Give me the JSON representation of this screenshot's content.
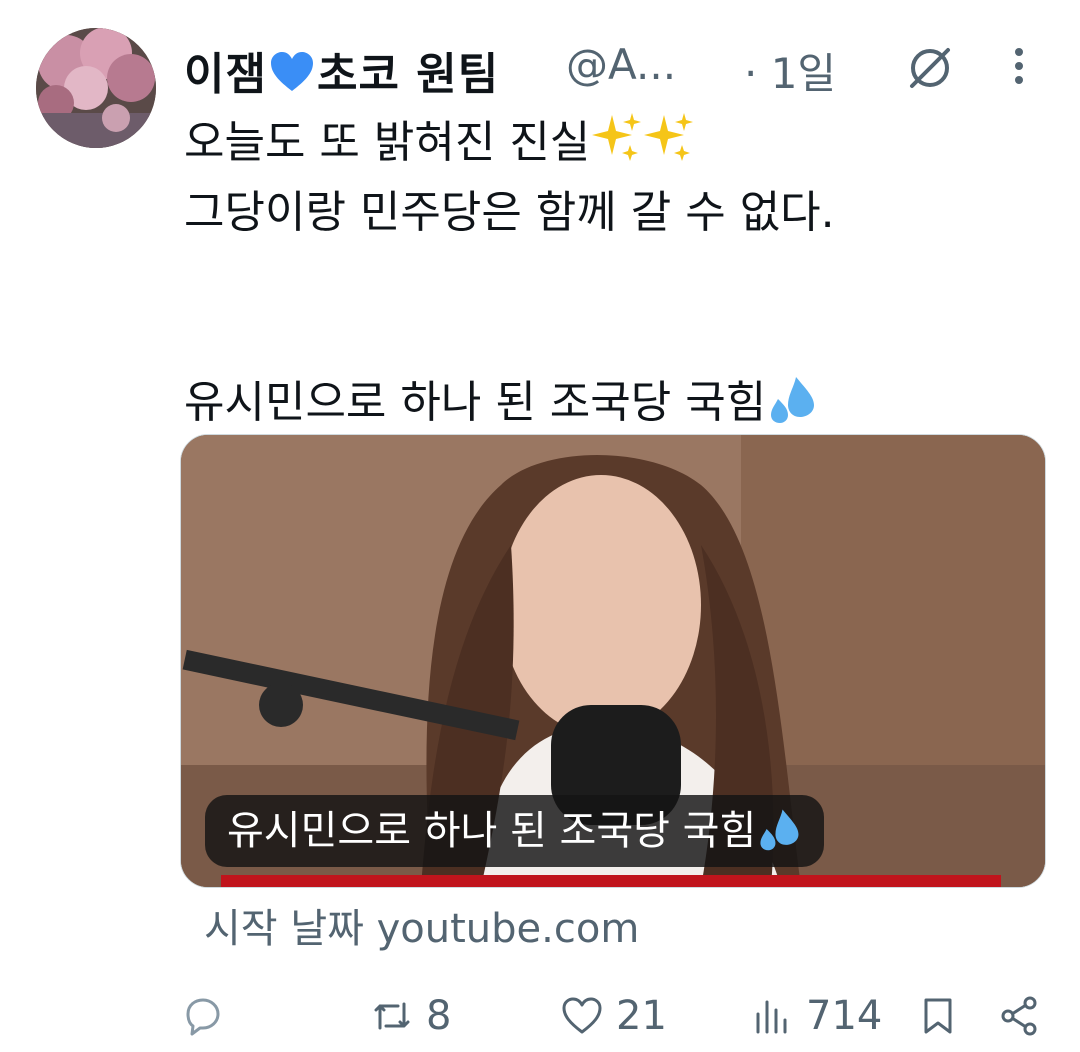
{
  "tweet": {
    "display_name_prefix": "이잼",
    "display_name_suffix": "초코 원팀",
    "handle": "@A...",
    "time": "· 1일",
    "text_line1": "오늘도 또 밝혀진 진실",
    "text_line2": "그당이랑 민주당은 함께 갈 수 없다.",
    "text_line3": "유시민으로 하나 된 조국당 국힘",
    "card_caption": "유시민으로 하나 된 조국당 국힘",
    "source_label": "시작 날짜 youtube.com"
  },
  "actions": {
    "reply_count": "",
    "retweet_count": "8",
    "like_count": "21",
    "views_count": "714"
  },
  "icons": {
    "heart_emoji": "blue-heart-icon",
    "sparkles": "sparkles-icon",
    "drops": "sweat-droplets-icon",
    "grok": "grok-icon",
    "more": "more-icon",
    "reply": "reply-icon",
    "retweet": "retweet-icon",
    "like": "like-icon",
    "views": "views-icon",
    "bookmark": "bookmark-icon",
    "share": "share-icon"
  },
  "colors": {
    "text": "#0f1419",
    "secondary": "#536471",
    "heart_blue": "#3a8ef6"
  }
}
